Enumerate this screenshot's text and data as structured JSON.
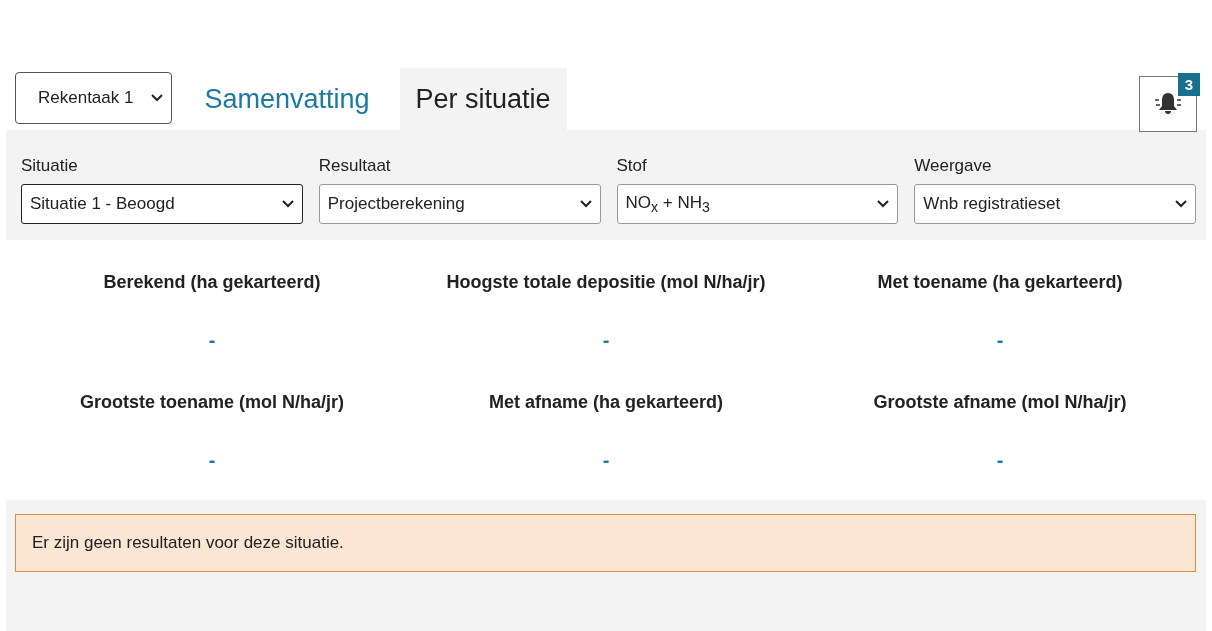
{
  "task_select": {
    "value": "Rekentaak 1"
  },
  "tabs": [
    {
      "label": "Samenvatting",
      "selected": false
    },
    {
      "label": "Per situatie",
      "selected": true
    }
  ],
  "notifications": {
    "count": "3"
  },
  "filters": [
    {
      "label": "Situatie",
      "value": "Situatie 1 - Beoogd",
      "focused": true
    },
    {
      "label": "Resultaat",
      "value": "Projectberekening",
      "focused": false
    },
    {
      "label": "Stof",
      "value": "NO$_{x}$ + NH$_{3}$",
      "focused": false
    },
    {
      "label": "Weergave",
      "value": "Wnb registratieset",
      "focused": false
    }
  ],
  "stats": [
    {
      "label": "Berekend (ha gekarteerd)",
      "value": "-"
    },
    {
      "label": "Hoogste totale depositie (mol N/ha/jr)",
      "value": "-"
    },
    {
      "label": "Met toename (ha gekarteerd)",
      "value": "-"
    },
    {
      "label": "Grootste toename (mol N/ha/jr)",
      "value": "-"
    },
    {
      "label": "Met afname (ha gekarteerd)",
      "value": "-"
    },
    {
      "label": "Grootste afname (mol N/ha/jr)",
      "value": "-"
    }
  ],
  "alert": {
    "text": "Er zijn geen resultaten voor deze situatie."
  }
}
